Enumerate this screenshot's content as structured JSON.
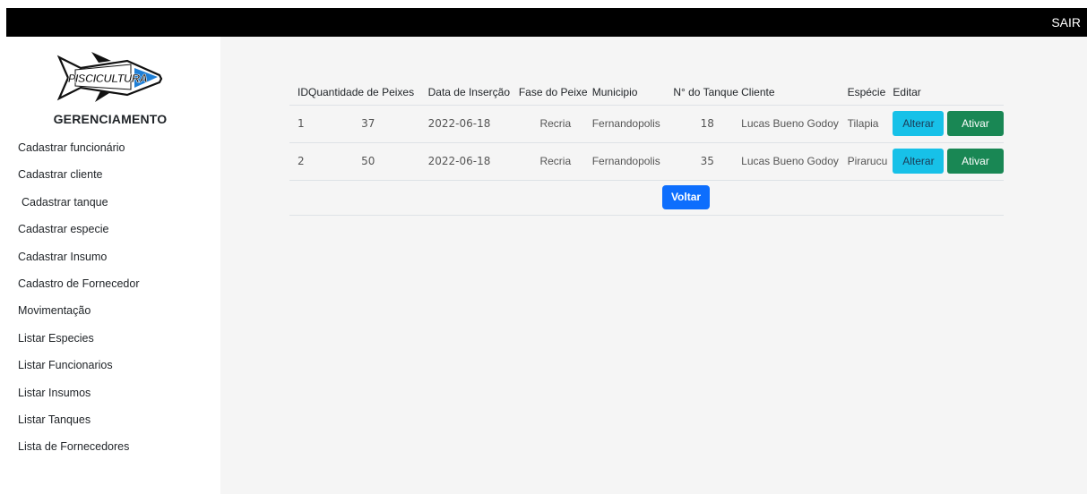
{
  "header": {
    "logout_label": "SAIR"
  },
  "sidebar": {
    "logo_text": "PISCICULTURA",
    "brand": "GERENCIAMENTO",
    "items": [
      {
        "label": "Cadastrar funcionário"
      },
      {
        "label": "Cadastrar cliente"
      },
      {
        "label": "Cadastrar tanque"
      },
      {
        "label": "Cadastrar especie"
      },
      {
        "label": "Cadastrar Insumo"
      },
      {
        "label": "Cadastro de Fornecedor"
      },
      {
        "label": "Movimentação"
      },
      {
        "label": "Listar Especies"
      },
      {
        "label": "Listar Funcionarios"
      },
      {
        "label": "Listar Insumos"
      },
      {
        "label": "Listar Tanques"
      },
      {
        "label": "Lista de Fornecedores"
      }
    ]
  },
  "table": {
    "columns": [
      "ID",
      "Quantidade de Peixes",
      "Data de Inserção",
      "Fase do Peixe",
      "Municipio",
      "N° do Tanque",
      "Cliente",
      "Espécie",
      "Editar"
    ],
    "rows": [
      {
        "id": "1",
        "quantidade": "37",
        "data": "2022-06-18",
        "fase": "Recria",
        "municipio": "Fernandopolis",
        "tanque": "18",
        "cliente": "Lucas Bueno Godoy",
        "especie": "Tilapia",
        "edit_label": "Alterar",
        "action_label": "Ativar"
      },
      {
        "id": "2",
        "quantidade": "50",
        "data": "2022-06-18",
        "fase": "Recria",
        "municipio": "Fernandopolis",
        "tanque": "35",
        "cliente": "Lucas Bueno Godoy",
        "especie": "Pirarucu",
        "edit_label": "Alterar",
        "action_label": "Ativar"
      }
    ]
  },
  "actions": {
    "back_label": "Voltar"
  },
  "colors": {
    "topbar": "#000000",
    "content_bg": "#f5f5f5",
    "alterar": "#17c1e8",
    "ativar": "#198754",
    "voltar": "#0d6efd",
    "logo_blue": "#1f7fd6"
  }
}
